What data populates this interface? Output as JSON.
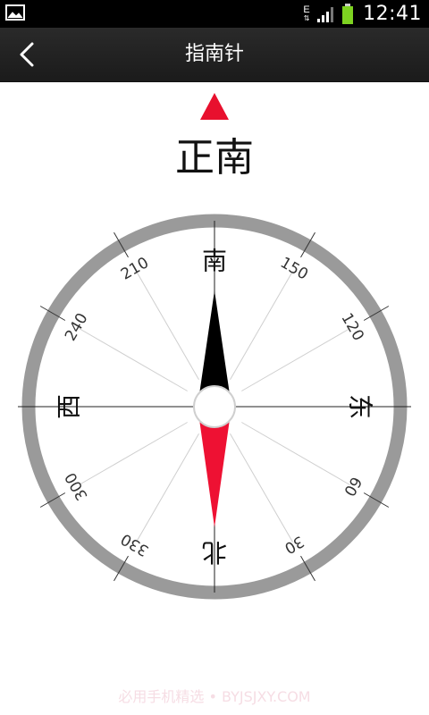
{
  "status_bar": {
    "network_type": "E",
    "network_arrows": "⇅",
    "time": "12:41",
    "battery_color": "#7ed321"
  },
  "header": {
    "title": "指南针",
    "back_icon": "chevron-left-icon"
  },
  "compass": {
    "direction_label": "正南",
    "pointer_color": "#e8102e",
    "heading_degrees": 180,
    "cardinals": {
      "south": "南",
      "west": "西",
      "north": "北",
      "east": "东"
    },
    "degree_labels": [
      "30",
      "60",
      "120",
      "150",
      "210",
      "240",
      "300",
      "330"
    ],
    "needle_dark_color": "#000000",
    "needle_red_color": "#ee1133",
    "ring_color": "#9a9a9a"
  },
  "footer": {
    "watermark": "必用手机精选 • BYJSJXY.COM"
  }
}
